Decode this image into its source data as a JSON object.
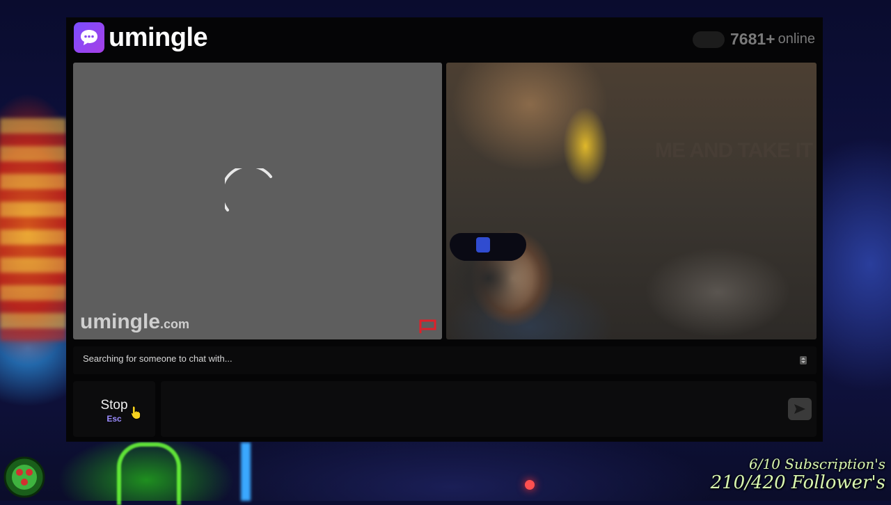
{
  "app": {
    "logo_text": "umingle",
    "online_count": "7681+",
    "online_label": "online"
  },
  "remote_video": {
    "watermark_main": "umingle",
    "watermark_tld": ".com"
  },
  "self_video": {
    "wall_banner_text": "ME AND TAKE IT"
  },
  "status": {
    "message": "Searching for someone to chat with..."
  },
  "controls": {
    "stop_label": "Stop",
    "stop_shortcut": "Esc",
    "chat_placeholder": ""
  },
  "stream_overlay": {
    "subscriptions": "6/10 Subscription's",
    "followers": "210/420 Follower's"
  },
  "icons": {
    "logo": "chat-bubble-icon",
    "spinner": "loading-spinner-icon",
    "report": "report-flag-icon",
    "scroll": "scroll-arrows-icon",
    "send": "send-arrow-icon",
    "cursor": "hand-pointer-icon",
    "overlay": "green-badge-icon"
  },
  "colors": {
    "brand_purple": "#8a4cf0",
    "report_red": "#e0202a",
    "shortcut_purple": "#9b8cff",
    "overlay_text": "#d9f7b0"
  }
}
